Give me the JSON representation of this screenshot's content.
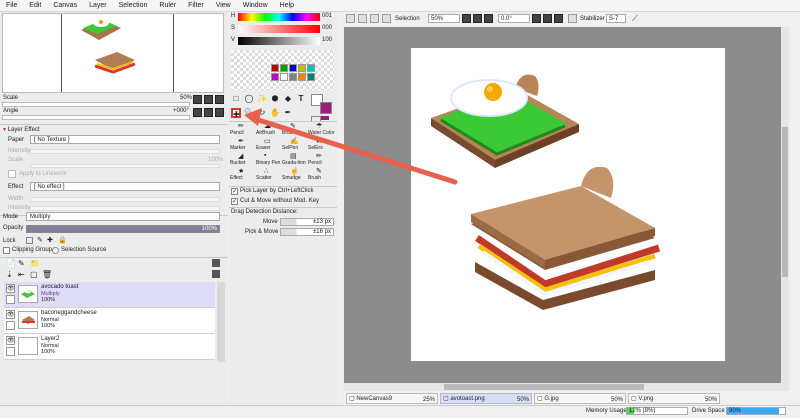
{
  "menu": [
    "File",
    "Edit",
    "Canvas",
    "Layer",
    "Selection",
    "Ruler",
    "Filter",
    "View",
    "Window",
    "Help"
  ],
  "navigator": {
    "scale_label": "Scale",
    "scale_value": "50%",
    "angle_label": "Angle",
    "angle_value": "+000°"
  },
  "layer_effect": {
    "header": "Layer Effect",
    "paper_label": "Paper",
    "paper_value": "[ No Texture ]",
    "intensity_label": "Intensity",
    "scale_label": "Scale",
    "scale_value": "100%",
    "apply_label": "Apply to Linework",
    "effect_label": "Effect",
    "effect_value": "[ No effect ]",
    "width_label": "Width",
    "intensity2_label": "Intensity"
  },
  "layer_props": {
    "mode_label": "Mode",
    "mode_value": "Multiply",
    "opacity_label": "Opacity",
    "opacity_value": "100%",
    "lock_label": "Lock",
    "clipping_label": "Clipping Group",
    "selection_source_label": "Selection Source"
  },
  "layers": [
    {
      "name": "avocado toast",
      "mode": "Multiply",
      "opacity": "100%"
    },
    {
      "name": "baconeggandcheese",
      "mode": "Normal",
      "opacity": "100%"
    },
    {
      "name": "Layer2",
      "mode": "Normal",
      "opacity": "100%"
    }
  ],
  "color": {
    "h_label": "H",
    "h_value": "001",
    "s_label": "S",
    "s_value": "000",
    "v_label": "V",
    "v_value": "100",
    "main_color": "#ffffff",
    "sub_color": "#9c1c7c",
    "swatches": [
      "#c00000",
      "#00a000",
      "#0000c0",
      "#c0c000",
      "#00c0c0",
      "#c000c0",
      "#ffffff",
      "#808080",
      "#ff8000",
      "#008080"
    ]
  },
  "tools": {
    "brush_names": [
      "Pencil",
      "AirBrush",
      "Brush",
      "Water Color",
      "Marker",
      "Eraser",
      "SelPen",
      "SelErs",
      "Bucket",
      "Binary Pen",
      "Grada-tion",
      "Pencil",
      "Effect",
      "Scatter",
      "Smudge",
      "Brush"
    ],
    "pick_layer_label": "Pick Layer by Ctrl+LeftClick",
    "cut_move_label": "Cut & Move without Mod. Key",
    "drag_detection_label": "Drag Detection Distance:",
    "move_label": "Move",
    "move_value": "±13 px",
    "pick_move_label": "Pick & Move",
    "pick_move_value": "±16 px"
  },
  "toolbar": {
    "selection_label": "Selection",
    "selection_value": "50%",
    "angle_value": "0.0°",
    "stabilizer_label": "Stabilizer",
    "stabilizer_value": "S-7"
  },
  "tabs": [
    {
      "name": "NewCanvas9",
      "zoom": "25%"
    },
    {
      "name": "avotoast.png",
      "zoom": "50%"
    },
    {
      "name": "G.jpg",
      "zoom": "50%"
    },
    {
      "name": "V.png",
      "zoom": "50%"
    }
  ],
  "status": {
    "memory_label": "Memory Usage",
    "memory_value": "12% (8%)",
    "memory_fraction": 0.12,
    "drive_label": "Drive Space",
    "drive_value": "90%",
    "drive_fraction": 0.9
  }
}
